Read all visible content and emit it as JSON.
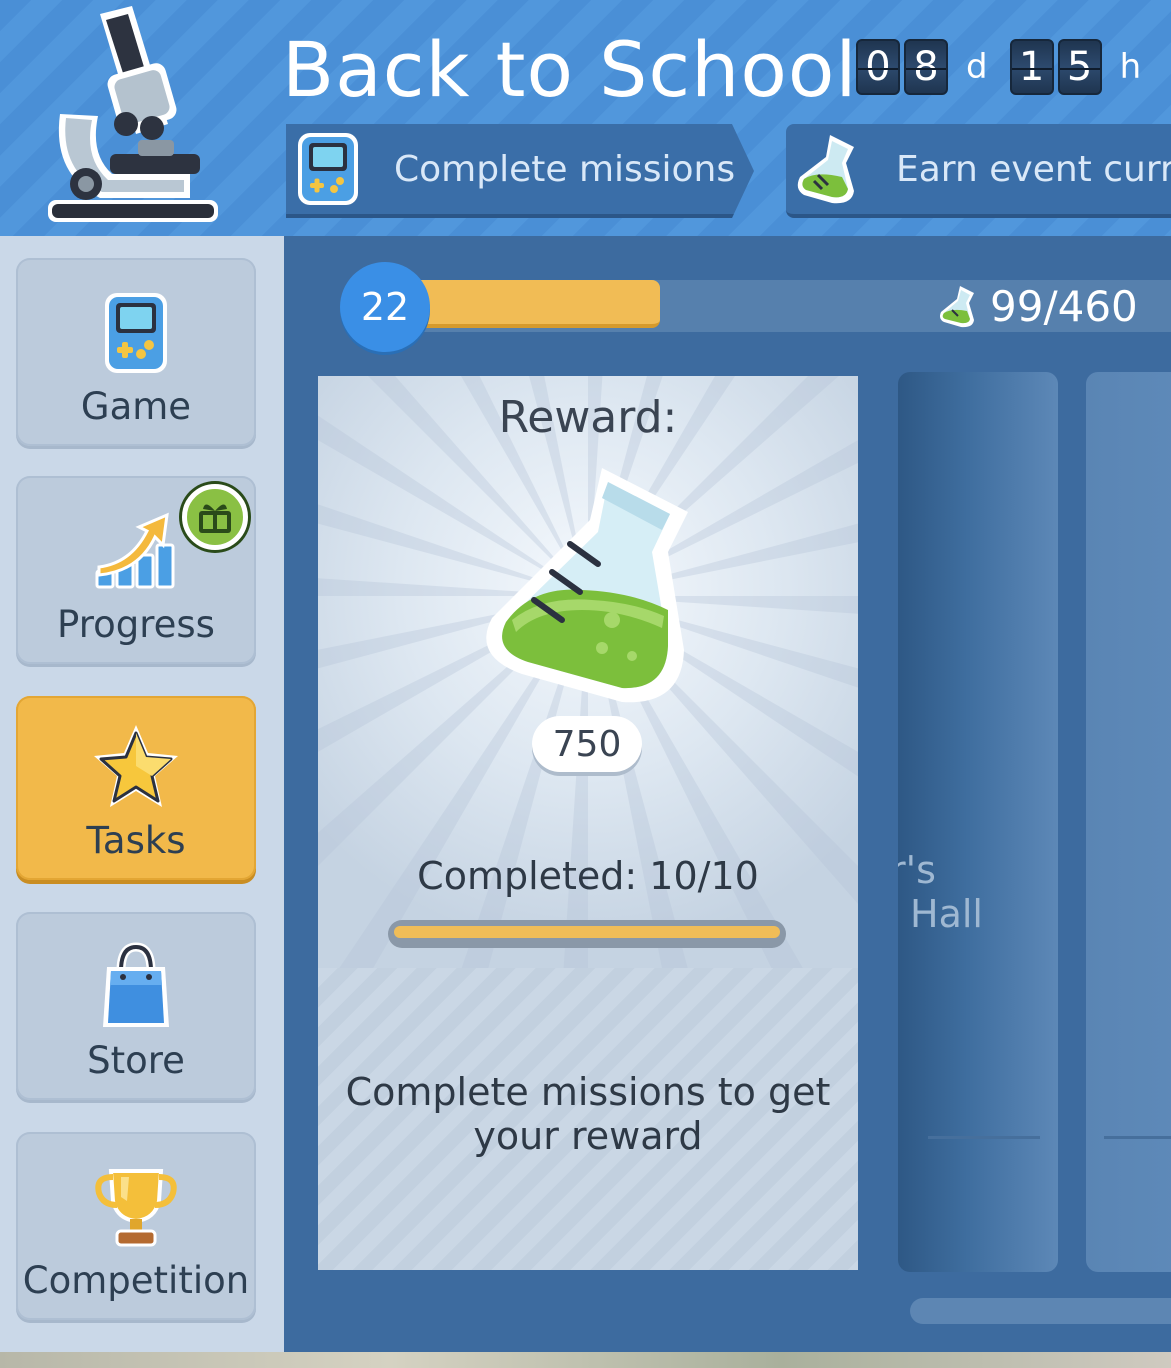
{
  "header": {
    "title": "Back to School",
    "timer": {
      "days_digits": [
        "0",
        "8"
      ],
      "days_unit": "d",
      "hours_digits": [
        "1",
        "5"
      ],
      "hours_unit": "h"
    },
    "steps": [
      {
        "label": "Complete missions",
        "icon": "game-console-icon"
      },
      {
        "label": "Earn event curre",
        "icon": "flask-icon"
      }
    ]
  },
  "sidebar": {
    "items": [
      {
        "label": "Game",
        "icon": "game-console-icon",
        "active": false
      },
      {
        "label": "Progress",
        "icon": "progress-chart-icon",
        "active": false,
        "badge": "gift-icon"
      },
      {
        "label": "Tasks",
        "icon": "star-icon",
        "active": true
      },
      {
        "label": "Store",
        "icon": "shopping-bag-icon",
        "active": false
      },
      {
        "label": "Competition",
        "icon": "trophy-icon",
        "active": false
      }
    ]
  },
  "main": {
    "level": "22",
    "level_progress_fraction": 0.33,
    "currency": {
      "icon": "flask-icon",
      "text": "99/460"
    },
    "card": {
      "title": "Reward:",
      "reward_amount": "750",
      "completed": "Completed: 10/10",
      "completed_fraction": 1.0,
      "description_line1": "Complete missions to get",
      "description_line2": "your reward"
    },
    "side_panel_text_line1": "r's",
    "side_panel_text_line2": "Hall"
  },
  "colors": {
    "header_blue": "#4a8fd6",
    "accent_orange": "#f2b94a",
    "level_blue": "#3a8fe6",
    "flask_green": "#7cbf3c"
  }
}
